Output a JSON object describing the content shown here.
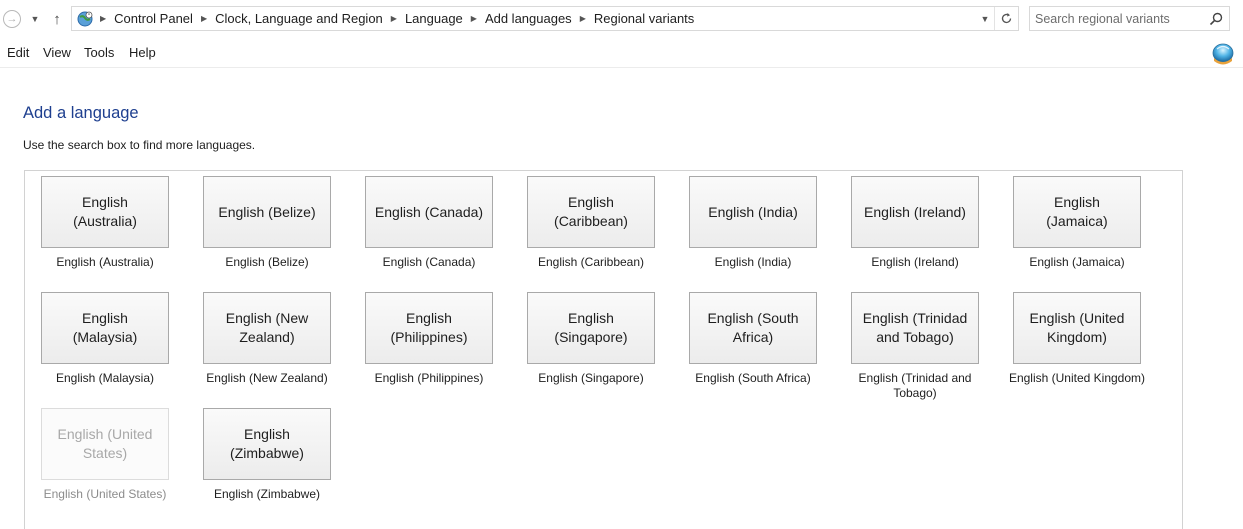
{
  "address_bar": {
    "breadcrumbs": [
      "Control Panel",
      "Clock, Language and Region",
      "Language",
      "Add languages",
      "Regional variants"
    ],
    "search_placeholder": "Search regional variants"
  },
  "menu": {
    "items": [
      "Edit",
      "View",
      "Tools",
      "Help"
    ]
  },
  "page": {
    "title": "Add a language",
    "description": "Use the search box to find more languages."
  },
  "languages": [
    {
      "tile": "English (Australia)",
      "caption": "English (Australia)",
      "enabled": true
    },
    {
      "tile": "English (Belize)",
      "caption": "English (Belize)",
      "enabled": true
    },
    {
      "tile": "English (Canada)",
      "caption": "English (Canada)",
      "enabled": true
    },
    {
      "tile": "English (Caribbean)",
      "caption": "English (Caribbean)",
      "enabled": true
    },
    {
      "tile": "English (India)",
      "caption": "English (India)",
      "enabled": true
    },
    {
      "tile": "English (Ireland)",
      "caption": "English (Ireland)",
      "enabled": true
    },
    {
      "tile": "English (Jamaica)",
      "caption": "English (Jamaica)",
      "enabled": true
    },
    {
      "tile": "English (Malaysia)",
      "caption": "English (Malaysia)",
      "enabled": true
    },
    {
      "tile": "English (New Zealand)",
      "caption": "English (New Zealand)",
      "enabled": true
    },
    {
      "tile": "English (Philippines)",
      "caption": "English (Philippines)",
      "enabled": true
    },
    {
      "tile": "English (Singapore)",
      "caption": "English (Singapore)",
      "enabled": true
    },
    {
      "tile": "English (South Africa)",
      "caption": "English (South Africa)",
      "enabled": true
    },
    {
      "tile": "English (Trinidad and Tobago)",
      "caption": "English (Trinidad and Tobago)",
      "enabled": true
    },
    {
      "tile": "English (United Kingdom)",
      "caption": "English (United Kingdom)",
      "enabled": true
    },
    {
      "tile": "English (United States)",
      "caption": "English (United States)",
      "enabled": false
    },
    {
      "tile": "English (Zimbabwe)",
      "caption": "English (Zimbabwe)",
      "enabled": true
    }
  ],
  "icons": {
    "back": "back-arrow-icon",
    "recent": "chevron-down-icon",
    "up": "up-arrow-icon",
    "location": "clock-language-region-icon",
    "refresh": "refresh-icon",
    "search": "search-icon",
    "help": "help-orb-icon"
  },
  "colors": {
    "title": "#1e3f8f",
    "tile_border": "#a9a9a9",
    "disabled_text": "#a8a8a8"
  }
}
